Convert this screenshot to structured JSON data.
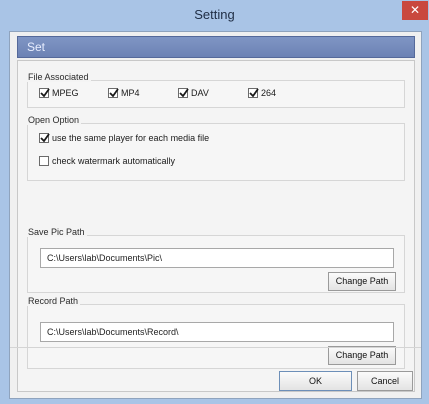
{
  "window": {
    "title": "Setting",
    "close_glyph": "✕"
  },
  "section_title": "Set",
  "file_associated": {
    "label": "File Associated",
    "options": [
      {
        "label": "MPEG",
        "checked": true
      },
      {
        "label": "MP4",
        "checked": true
      },
      {
        "label": "DAV",
        "checked": true
      },
      {
        "label": "264",
        "checked": true
      }
    ]
  },
  "open_option": {
    "label": "Open Option",
    "same_player": {
      "label": "use the same player for each media file",
      "checked": true
    },
    "watermark": {
      "label": "check watermark automatically",
      "checked": false
    }
  },
  "save_pic_path": {
    "label": "Save Pic Path",
    "value": "C:\\Users\\lab\\Documents\\Pic\\",
    "button": "Change Path"
  },
  "record_path": {
    "label": "Record Path",
    "value": "C:\\Users\\lab\\Documents\\Record\\",
    "button": "Change Path"
  },
  "footer": {
    "ok": "OK",
    "cancel": "Cancel"
  },
  "colors": {
    "accent": "#6c82b4",
    "close": "#c9483e"
  }
}
